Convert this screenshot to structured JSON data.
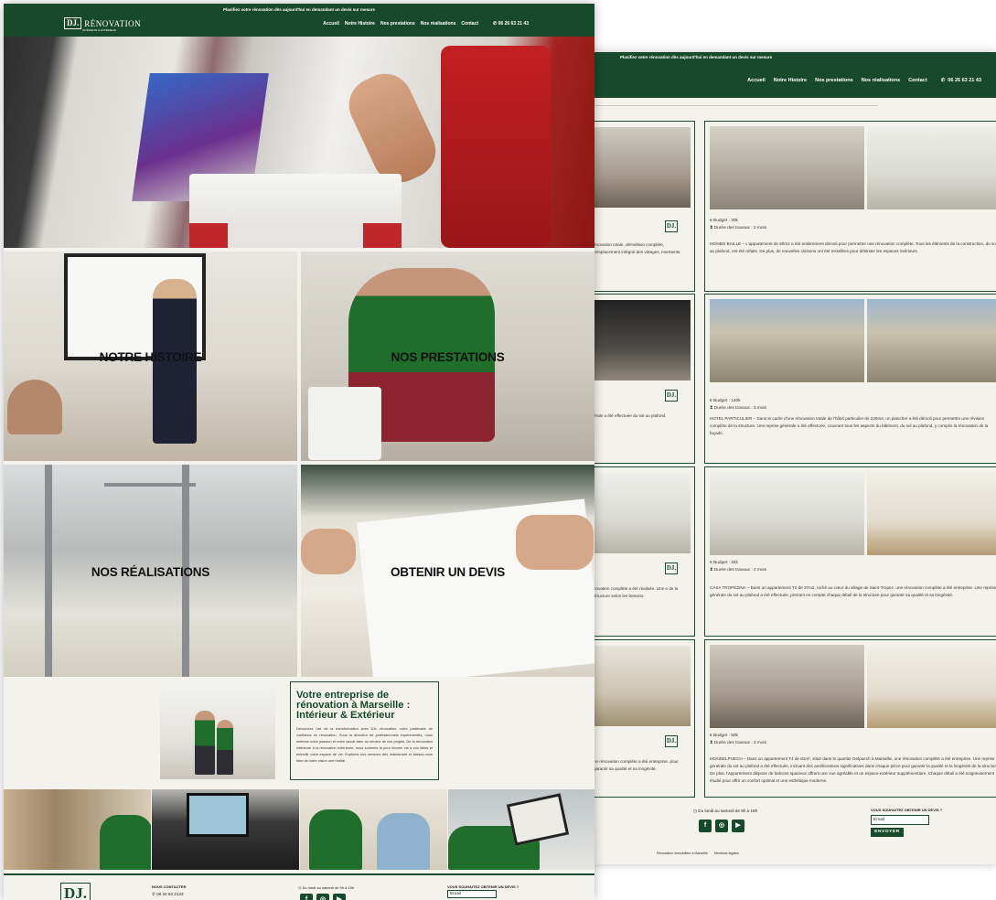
{
  "banner": "Planifiez votre rénovation dès aujourd'hui en demandant un devis sur mesure",
  "brand": {
    "mark": "DJ.",
    "name": "RÉNOVATION",
    "tagline": "INTÉRIEUR & EXTÉRIEUR"
  },
  "nav": {
    "items": [
      "Accueil",
      "Notre Histoire",
      "Nos prestations",
      "Nos réalisations",
      "Contact"
    ],
    "phone": "06 26 63 21 43"
  },
  "tiles": [
    "NOTRE HISTOIRE",
    "NOS PRESTATIONS",
    "NOS RÉALISATIONS",
    "OBTENIR UN DEVIS"
  ],
  "about": {
    "title": "Votre entreprise de rénovation à Marseille : Intérieur & Extérieur",
    "text": "Découvrez l'art de la transformation avec DJL rénovation, votre partenaire de confiance en rénovation. Sous la direction de professionnels expérimentés, nous mettons notre passion et notre savoir-faire au service de vos projets. De la rénovation intérieure à la rénovation extérieure, nous sommes là pour donner vie à vos idées et embellir votre espace de vie. Explorez nos services dès maintenant et laissez-vous faire de votre vision une réalité."
  },
  "footer": {
    "contact_heading": "NOUS CONTACTER",
    "phone": "06 26 63 2143",
    "hours": "Du lundi au samedi de 9h à 19h",
    "quote_heading": "VOUS SOUHAITEZ OBTENIR UN DEVIS ?",
    "email_placeholder": "Email",
    "send_label": "ENVOYER",
    "links": [
      "Rénovation immobilière à Marseille",
      "Mentions légales"
    ]
  },
  "projects": [
    {
      "left_text": "énovation totale, démolition complète, remplacement intégral des vitrages, nnements.",
      "budget": "Budget : 30k",
      "duration": "Durée des travaux : 2 mois",
      "description": "MONBO BAILLE – L'appartement de 50m2 a été entièrement démoli pour permettre une rénovation complète. Tous les éléments de la construction, du sol au plafond, ont été refaits. De plus, de nouvelles cloisons ont été installées pour délimiter les espaces intérieurs"
    },
    {
      "left_text": "érale a été effectuée du sol au plafond.",
      "budget": "Budget : 140k",
      "duration": "Durée des travaux : 3 mois",
      "description": "HOTEL PARTICULIER – Dans le cadre d'une rénovation totale de l'hôtel particulier de 220m2, un plancher a été démoli pour permettre une révision complète de la structure. Une reprise générale a été effectuée, couvrant tous les aspects du bâtiment, du sol au plafond, y compris la rénovation de la façade."
    },
    {
      "left_text": "novation complète a été réalisée. Une e de la structure selon les besoins.",
      "budget": "Budget : 34k",
      "duration": "Durée des travaux : 2 mois",
      "description": "CASA TROPEZINA – Dans un appartement T2 de 37m2, niché au cœur du village de Saint-Tropez, une rénovation complète a été entreprise. Une reprise générale du sol au plafond a été effectuée, prenant en compte chaque détail de la structure pour garantir sa qualité et sa longévité."
    },
    {
      "left_text": "ne rénovation complète a été entreprise. pour garantir sa qualité et sa longévité.",
      "budget": "Budget : 50k",
      "duration": "Durée des travaux : 3 mois",
      "description": "MONDELPUECH – Dans un appartement T4 de 81m², situé dans le quartier Delpuech à Marseille, une rénovation complète a été entreprise. Une reprise générale du sol au plafond a été effectuée, incluant des améliorations significatives dans chaque pièce pour garantir la qualité et la longévité de la structure. De plus, l'appartement dispose de balcons spacieux offrant une vue agréable et un espace extérieur supplémentaire. Chaque détail a été soigneusement étudié pour offrir un confort optimal et une esthétique moderne."
    }
  ]
}
